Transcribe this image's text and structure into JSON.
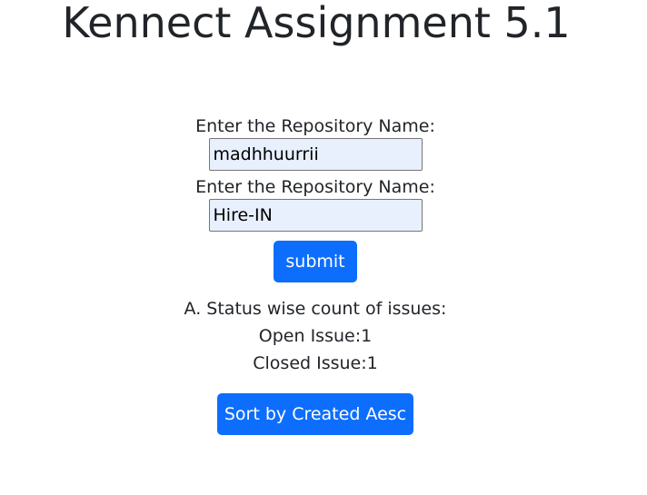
{
  "page": {
    "title": "Kennect Assignment 5.1"
  },
  "form": {
    "owner_label": "Enter the Repository Name:",
    "owner_value": "madhhuurrii",
    "repo_label": "Enter the Repository Name:",
    "repo_value": "Hire-IN",
    "submit_label": "submit"
  },
  "results": {
    "heading": "A. Status wise count of issues:",
    "open_issues": "Open Issue:1",
    "closed_issues": "Closed Issue:1"
  },
  "actions": {
    "sort_label": "Sort by Created Aesc"
  },
  "colors": {
    "primary": "#0d6efd",
    "input_autofill_bg": "#e8f0fe",
    "text": "#212529"
  }
}
